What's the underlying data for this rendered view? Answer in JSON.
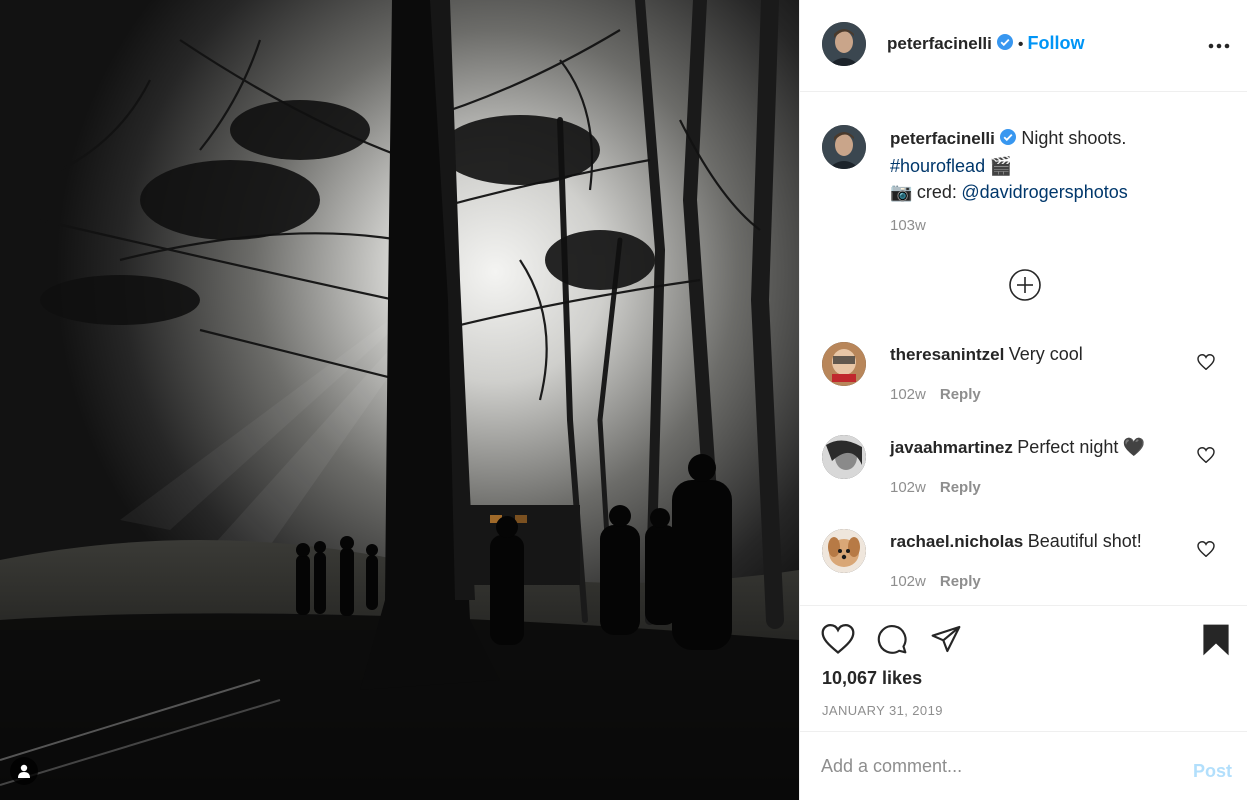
{
  "post": {
    "username": "peterfacinelli",
    "follow_label": "Follow",
    "separator": "•",
    "more_icon": "more-horizontal-icon"
  },
  "caption": {
    "username": "peterfacinelli",
    "text_line1": "Night shoots.",
    "hashtag": "#houroflead",
    "emoji_clapper": "🎬",
    "emoji_camera": "📷",
    "cred_text": "cred:",
    "mention": "@davidrogersphotos",
    "time": "103w"
  },
  "load_more_icon": "plus-circle-icon",
  "comments": [
    {
      "username": "theresanintzel",
      "text": "Very cool",
      "time": "102w",
      "reply": "Reply"
    },
    {
      "username": "javaahmartinez",
      "text": "Perfect night",
      "emoji": "🖤",
      "time": "102w",
      "reply": "Reply"
    },
    {
      "username": "rachael.nicholas",
      "text": "Beautiful shot!",
      "time": "102w",
      "reply": "Reply"
    }
  ],
  "likes": "10,067 likes",
  "date": "JANUARY 31, 2019",
  "add_comment": {
    "placeholder": "Add a comment...",
    "post_label": "Post"
  },
  "colors": {
    "accent": "#0095f6",
    "link": "#00376b",
    "muted": "#8e8e8e",
    "post_disabled": "#b2dffc"
  }
}
